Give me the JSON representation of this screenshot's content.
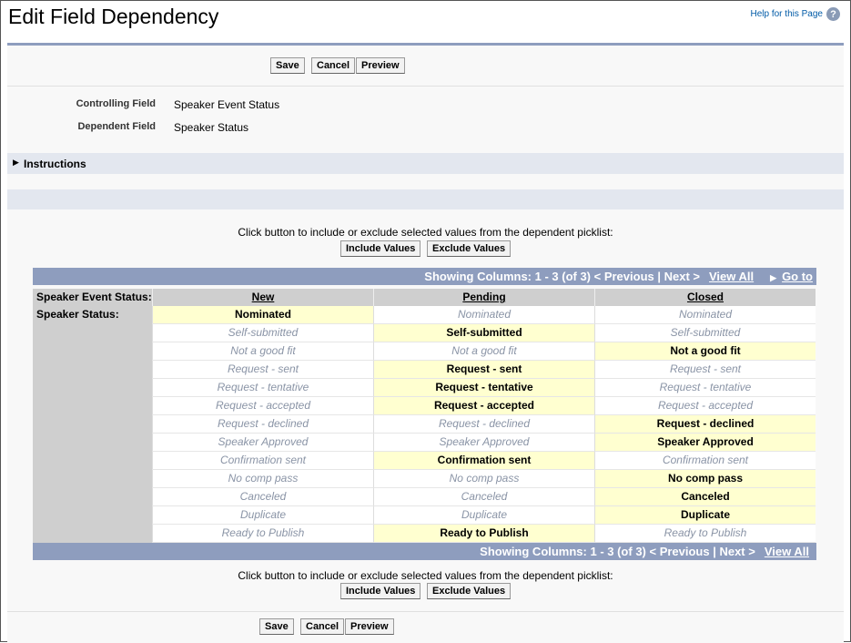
{
  "title": "Edit Field Dependency",
  "help": {
    "label": "Help for this Page",
    "icon": "help-icon"
  },
  "buttons": {
    "save": "Save",
    "cancel": "Cancel",
    "preview": "Preview",
    "include": "Include Values",
    "exclude": "Exclude Values"
  },
  "fields": {
    "controlling_label": "Controlling Field",
    "controlling_value": "Speaker Event Status",
    "dependent_label": "Dependent Field",
    "dependent_value": "Speaker Status"
  },
  "instructions": "Instructions",
  "hint": "Click button to include or exclude selected values from the dependent picklist:",
  "pager": {
    "showing": "Showing Columns: 1 - 3 (of 3) < Previous | Next >",
    "view_all": "View All",
    "go_to": "Go to"
  },
  "matrix": {
    "controlling_label": "Speaker Event Status:",
    "dependent_label": "Speaker Status:",
    "columns": [
      "New",
      "Pending",
      "Closed"
    ],
    "values": [
      "Nominated",
      "Self-submitted",
      "Not a good fit",
      "Request - sent",
      "Request - tentative",
      "Request - accepted",
      "Request - declined",
      "Speaker Approved",
      "Confirmation sent",
      "No comp pass",
      "Canceled",
      "Duplicate",
      "Ready to Publish"
    ],
    "included": [
      [
        0
      ],
      [
        1,
        3,
        4,
        5,
        8,
        12
      ],
      [
        2,
        6,
        7,
        9,
        10,
        11
      ]
    ]
  },
  "colors": {
    "included": "#ffffd0",
    "header_bar": "#8e9dbe"
  }
}
